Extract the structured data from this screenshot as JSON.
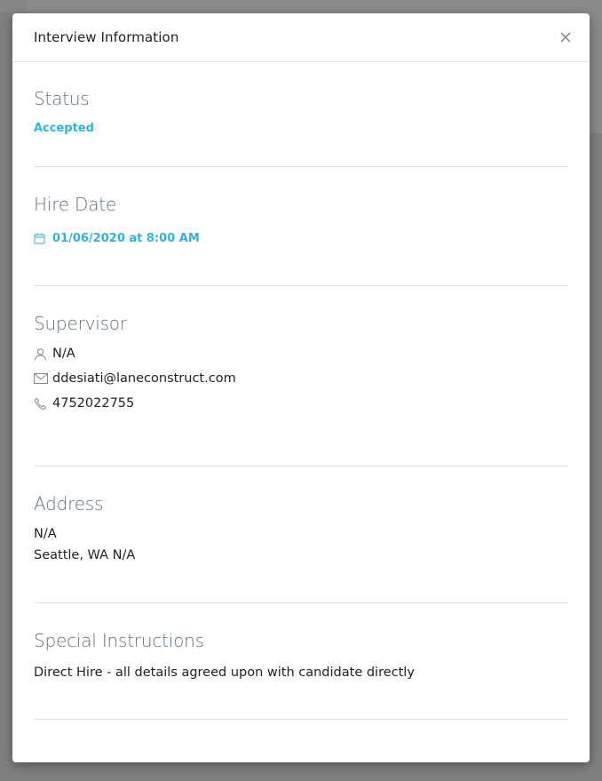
{
  "modal": {
    "title": "Interview Information"
  },
  "status": {
    "heading": "Status",
    "value": "Accepted"
  },
  "hire_date": {
    "heading": "Hire Date",
    "value": "01/06/2020 at 8:00 AM"
  },
  "supervisor": {
    "heading": "Supervisor",
    "name": "N/A",
    "email": "ddesiati@laneconstruct.com",
    "phone": "4752022755"
  },
  "address": {
    "heading": "Address",
    "line1": "N/A",
    "line2": "Seattle, WA N/A"
  },
  "special_instructions": {
    "heading": "Special Instructions",
    "text": "Direct Hire - all details agreed upon with candidate directly"
  },
  "colors": {
    "accent": "#2eb3e5",
    "heading": "#5d7285",
    "icon": "#7a8a99"
  }
}
